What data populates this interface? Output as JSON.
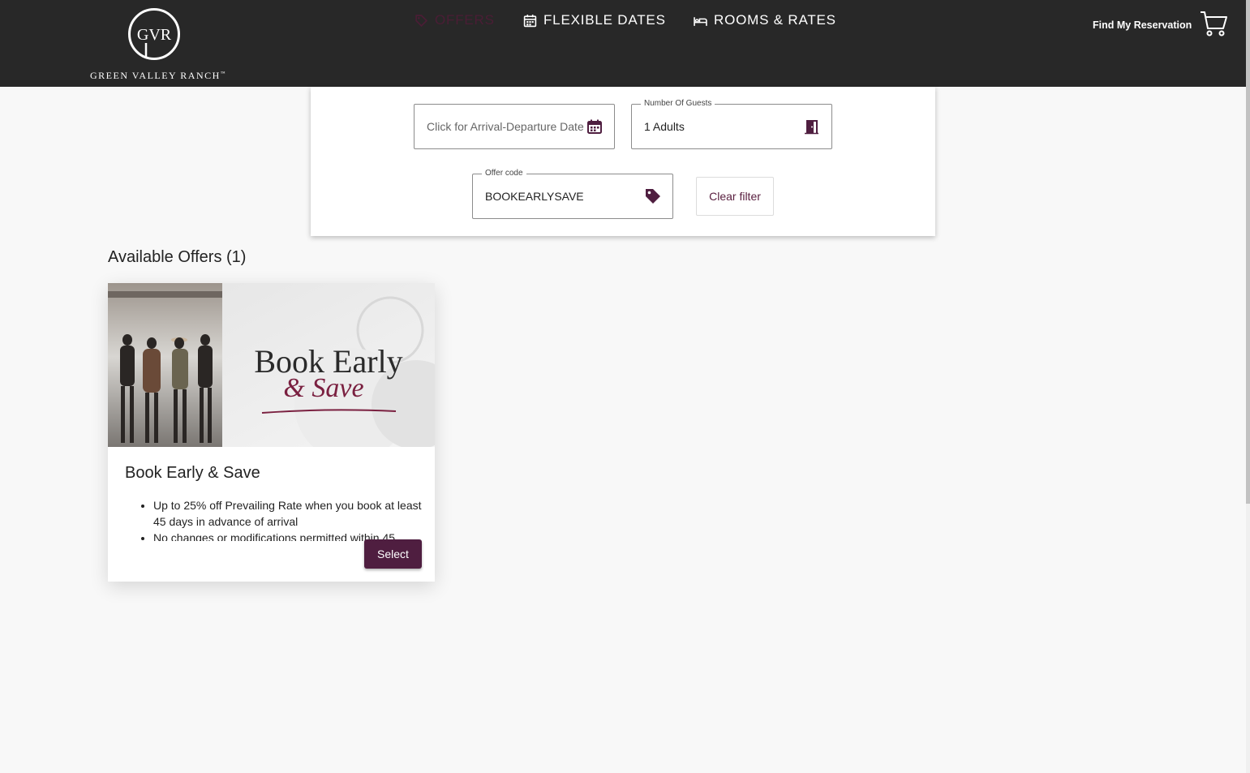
{
  "brand": {
    "monogram": "GVR",
    "name": "GREEN VALLEY RANCH",
    "trademark": "™"
  },
  "nav": {
    "offers": "OFFERS",
    "flexible_dates": "FLEXIBLE DATES",
    "rooms_rates": "ROOMS & RATES",
    "active": "offers"
  },
  "header": {
    "find_reservation": "Find My Reservation",
    "cart_icon": "cart-icon"
  },
  "search": {
    "dates_placeholder": "Click for Arrival-Departure Date",
    "guests_label": "Number Of Guests",
    "guests_value": "1 Adults",
    "offer_code_label": "Offer code",
    "offer_code_value": "BOOKEARLYSAVE",
    "clear_filter": "Clear filter"
  },
  "offers": {
    "heading": "Available Offers (1)",
    "items": [
      {
        "image_text_line1": "Book Early",
        "image_text_line2": "& Save",
        "title": "Book Early & Save",
        "bullets": [
          "Up to 25% off Prevailing Rate when you book at least 45 days in advance of arrival",
          "No changes or modifications permitted within 45"
        ],
        "select_label": "Select"
      }
    ]
  },
  "colors": {
    "header_bg": "#282828",
    "accent": "#4f1e40",
    "active_nav": "#4a1d35",
    "page_bg": "#f8f8f8"
  }
}
